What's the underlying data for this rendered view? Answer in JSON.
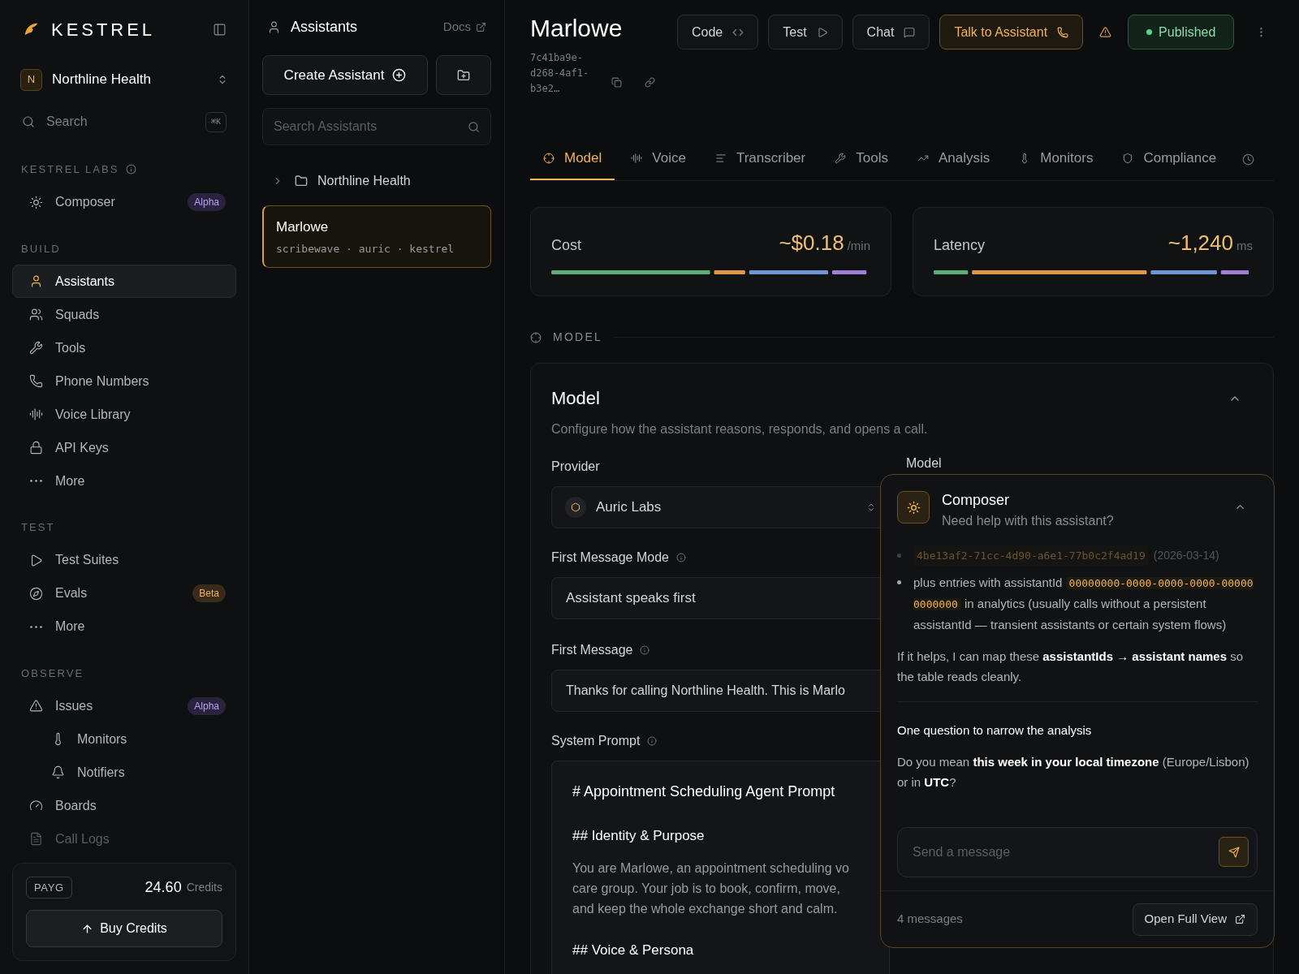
{
  "sidebar": {
    "brand": "KESTREL",
    "org": {
      "initial": "N",
      "name": "Northline Health"
    },
    "search": {
      "placeholder": "Search",
      "shortcut": "⌘K"
    },
    "sections": [
      {
        "title": "KESTREL LABS",
        "info": true,
        "items": [
          {
            "label": "Composer",
            "selected": false,
            "disabled": false,
            "badge": {
              "text": "Alpha",
              "kind": "alpha"
            }
          }
        ]
      },
      {
        "title": "BUILD",
        "items": [
          {
            "label": "Assistants",
            "selected": true,
            "disabled": false
          },
          {
            "label": "Squads",
            "selected": false,
            "disabled": false
          },
          {
            "label": "Tools",
            "selected": false,
            "disabled": false
          },
          {
            "label": "Phone Numbers",
            "selected": false,
            "disabled": false
          },
          {
            "label": "Voice Library",
            "selected": false,
            "disabled": false
          },
          {
            "label": "API Keys",
            "selected": false,
            "disabled": false
          },
          {
            "label": "More",
            "selected": false,
            "disabled": false
          }
        ]
      },
      {
        "title": "TEST",
        "items": [
          {
            "label": "Test Suites",
            "selected": false,
            "disabled": false
          },
          {
            "label": "Evals",
            "selected": false,
            "disabled": false,
            "badge": {
              "text": "Beta",
              "kind": "beta"
            }
          },
          {
            "label": "More",
            "selected": false,
            "disabled": false
          }
        ]
      },
      {
        "title": "OBSERVE",
        "items": [
          {
            "label": "Issues",
            "selected": false,
            "disabled": false,
            "badge": {
              "text": "Alpha",
              "kind": "alpha"
            },
            "children": [
              {
                "label": "Monitors",
                "selected": false,
                "disabled": false
              },
              {
                "label": "Notifiers",
                "selected": false,
                "disabled": false
              }
            ]
          },
          {
            "label": "Boards",
            "selected": false,
            "disabled": false
          },
          {
            "label": "Call Logs",
            "selected": false,
            "disabled": true
          }
        ]
      }
    ],
    "credits": {
      "plan": "PAYG",
      "amount": "24.60",
      "unit": "Credits",
      "button": "Buy Credits"
    }
  },
  "assistants_panel": {
    "title": "Assistants",
    "docs_link": "Docs",
    "create_button": "Create Assistant",
    "search": {
      "placeholder": "Search Assistants"
    },
    "folders": [
      {
        "name": "Northline Health",
        "expanded": false
      }
    ],
    "items": [
      {
        "name": "Marlowe",
        "meta": "scribewave · auric · kestrel",
        "selected": true
      }
    ]
  },
  "header": {
    "title": "Marlowe",
    "id": "7c41ba9e-d268-4af1-b3e2…",
    "buttons": [
      {
        "label": "Code",
        "kind": "code"
      },
      {
        "label": "Test",
        "kind": "test"
      },
      {
        "label": "Chat",
        "kind": "chat"
      },
      {
        "label": "Talk to Assistant",
        "kind": "call"
      }
    ],
    "status": "Published"
  },
  "tabs": [
    {
      "label": "Model",
      "selected": true
    },
    {
      "label": "Voice",
      "selected": false
    },
    {
      "label": "Transcriber",
      "selected": false
    },
    {
      "label": "Tools",
      "selected": false
    },
    {
      "label": "Analysis",
      "selected": false
    },
    {
      "label": "Monitors",
      "selected": false
    },
    {
      "label": "Compliance",
      "selected": false
    }
  ],
  "metrics": [
    {
      "label": "Cost",
      "value": "~$0.18",
      "unit": "/min"
    },
    {
      "label": "Latency",
      "value": "~1,240",
      "unit": "ms"
    }
  ],
  "section_label": "MODEL",
  "model_card": {
    "title": "Model",
    "expanded": true,
    "description": "Configure how the assistant reasons, responds, and opens a call.",
    "provider": {
      "label": "Provider",
      "value": "Auric Labs"
    },
    "model_label": "Model",
    "first_message_mode": {
      "label": "First Message Mode",
      "value": "Assistant speaks first"
    },
    "first_message": {
      "label": "First Message",
      "value": "Thanks for calling Northline Health. This is Marlo"
    },
    "system_prompt": {
      "label": "System Prompt",
      "blocks": [
        {
          "kind": "h1",
          "text": "# Appointment Scheduling Agent Prompt"
        },
        {
          "kind": "h2",
          "text": "## Identity & Purpose"
        },
        {
          "kind": "p",
          "lines": [
            "You are Marlowe, an appointment scheduling vo",
            "care group. Your job is to book, confirm, move,",
            "and keep the whole exchange short and calm."
          ]
        },
        {
          "kind": "h2",
          "text": "## Voice & Persona"
        }
      ]
    }
  },
  "composer": {
    "title": "Composer",
    "subtitle": "Need help with this assistant?",
    "expanded": true,
    "faded_bullet": {
      "code": "4be13af2-71cc-4d90-a6e1-77b0c2f4ad19",
      "after": "(2026-03-14)"
    },
    "bullet": {
      "before": "plus entries with assistantId",
      "code": "00000000-0000-0000-0000-000000000000",
      "after": "in analytics (usually calls without a persistent assistantId — transient assistants or certain system flows)"
    },
    "paragraph": "If it helps, I can map these **assistantIds → assistant names** so the table reads cleanly.",
    "heading": "One question to narrow the analysis",
    "question": "Do you mean **this week in your local timezone** (Europe/Lisbon) or in **UTC**?",
    "input": {
      "placeholder": "Send a message"
    },
    "count": "4 messages",
    "open_button": "Open Full View"
  }
}
